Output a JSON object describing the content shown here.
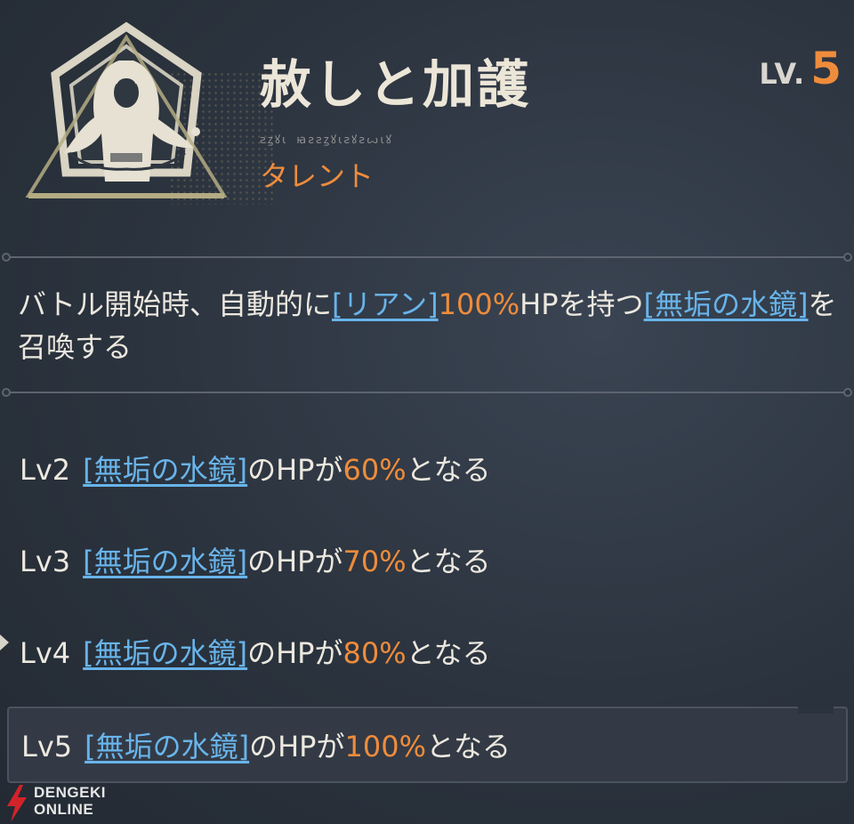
{
  "talent": {
    "emblem_icon": "goddess-emblem-icon",
    "title": "赦しと加護",
    "level_label": "LV.",
    "level_value": "5",
    "runes": "ꙅꙁꙋꙇ ꙗꙅꙅꙁꙋꙇꙅꙋꙅꙍꙇꙋ",
    "category": "タレント"
  },
  "description": {
    "part1": "バトル開始時、自動的に",
    "link1": "[リアン]",
    "percent": "100%",
    "part2": "HPを持つ",
    "link2": "[無垢の水鏡]",
    "part3": "を召喚する"
  },
  "levels": [
    {
      "lv": "Lv2",
      "link": "[無垢の水鏡]",
      "mid": "のHPが",
      "value": "60%",
      "end": "となる"
    },
    {
      "lv": "Lv3",
      "link": "[無垢の水鏡]",
      "mid": "のHPが",
      "value": "70%",
      "end": "となる"
    },
    {
      "lv": "Lv4",
      "link": "[無垢の水鏡]",
      "mid": "のHPが",
      "value": "80%",
      "end": "となる"
    },
    {
      "lv": "Lv5",
      "link": "[無垢の水鏡]",
      "mid": "のHPが",
      "value": "100%",
      "end": "となる"
    }
  ],
  "watermark": {
    "top": "DENGEKI",
    "bottom": "ONLINE",
    "icon": "lightning-bolt-icon"
  },
  "colors": {
    "accent_orange": "#ef8c3b",
    "link_blue": "#68b4ea",
    "text": "#ece8df",
    "background": "#2b333e",
    "watermark_red": "#d2232a"
  }
}
